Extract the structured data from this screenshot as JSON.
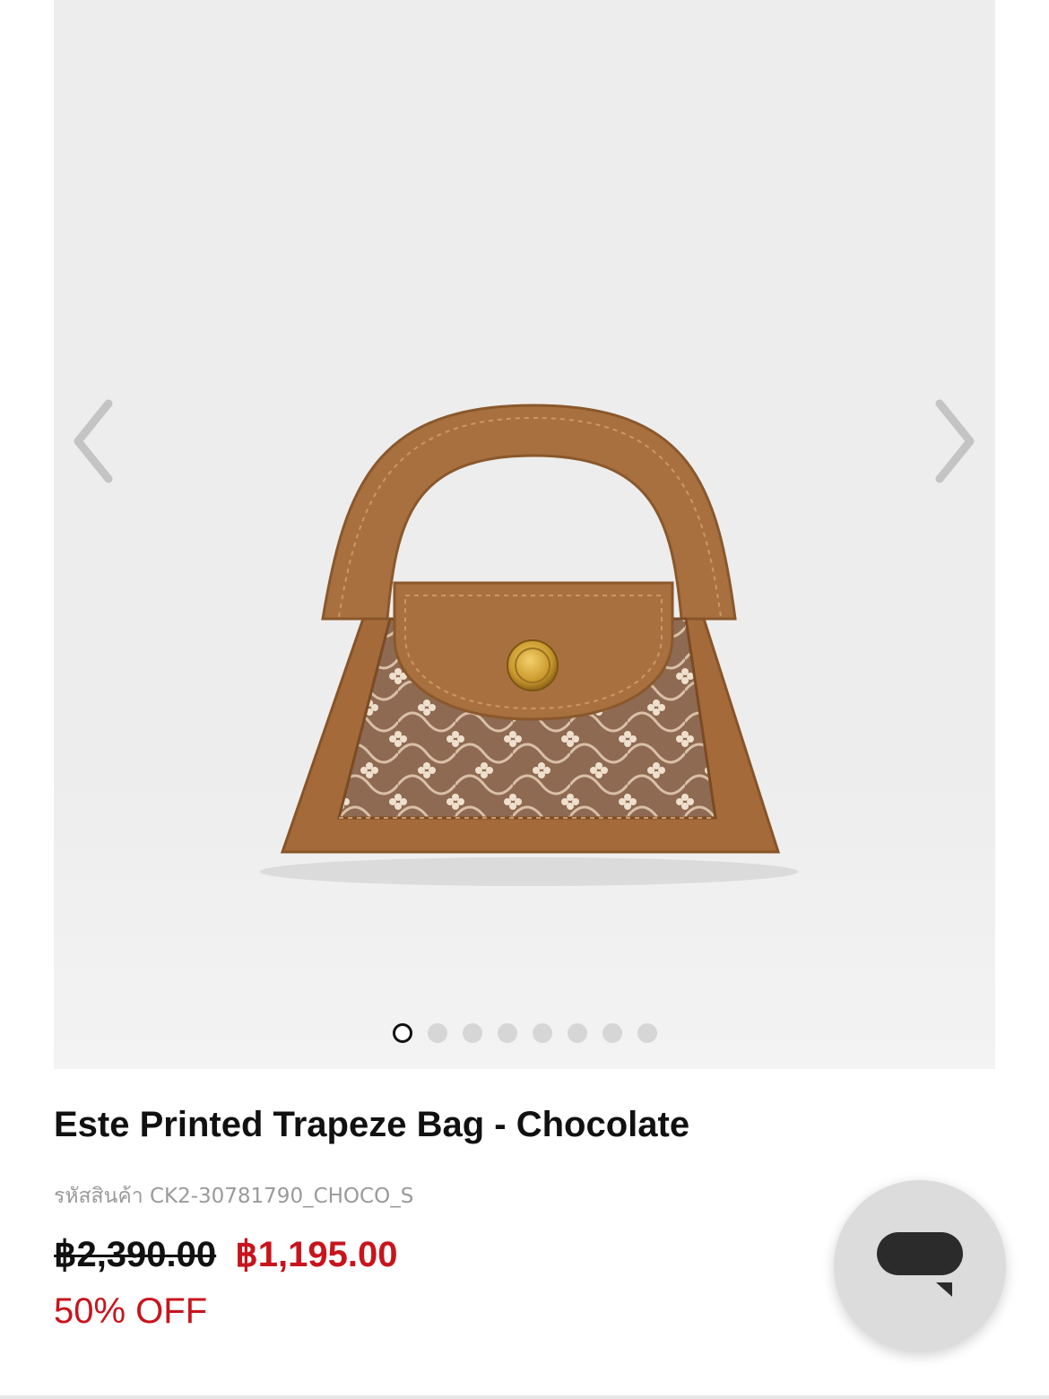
{
  "gallery": {
    "image_alt": "Este Printed Trapeze Bag - Chocolate",
    "prev_icon": "chevron-left-icon",
    "next_icon": "chevron-right-icon",
    "slide_count": 8,
    "active_slide": 1
  },
  "product": {
    "title": "Este Printed Trapeze Bag - Chocolate",
    "sku_label": "รหัสสินค้า",
    "sku": "CK2-30781790_CHOCO_S",
    "price_original": "฿2,390.00",
    "price_sale": "฿1,195.00",
    "discount": "50% OFF"
  },
  "chat": {
    "icon": "chat-bubble-icon"
  },
  "colors": {
    "sale_red": "#c8141d",
    "bag_brown": "#a46a3a",
    "gallery_bg": "#ededed"
  }
}
